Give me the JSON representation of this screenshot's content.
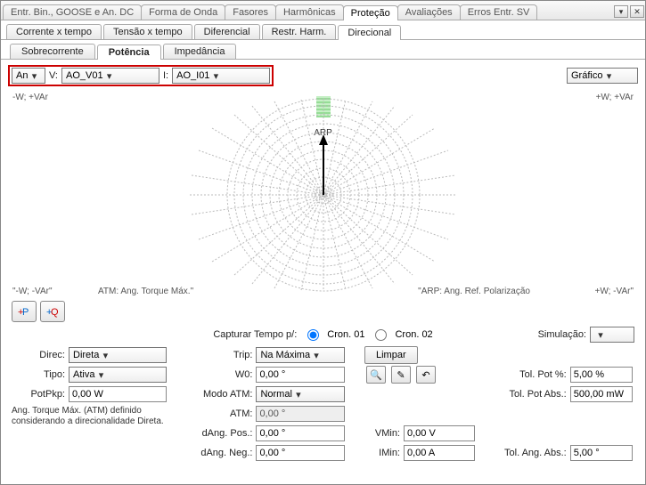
{
  "top_tabs": [
    "Entr. Bin., GOOSE e An. DC",
    "Forma de Onda",
    "Fasores",
    "Harmônicas",
    "Proteção",
    "Avaliações",
    "Erros Entr. SV"
  ],
  "top_active": 4,
  "row2_tabs": [
    "Corrente x tempo",
    "Tensão x tempo",
    "Diferencial",
    "Restr. Harm.",
    "Direcional"
  ],
  "row2_active": 4,
  "row3_tabs": [
    "Sobrecorrente",
    "Potência",
    "Impedância"
  ],
  "row3_active": 1,
  "sel": {
    "an": "An",
    "v_label": "V:",
    "v_val": "AO_V01",
    "i_label": "I:",
    "i_val": "AO_I01",
    "grafico": "Gráfico"
  },
  "chart": {
    "tl": "-W; +VAr",
    "tr": "+W; +VAr",
    "bl": "\"-W; -VAr\"",
    "br": "+W; -VAr\"",
    "arp": "ARP",
    "leg_l": "ATM: Ang. Torque Máx.\"",
    "leg_r": "\"ARP: Ang. Ref. Polarização"
  },
  "capture_label": "Capturar Tempo p/:",
  "cron1": "Cron. 01",
  "cron2": "Cron. 02",
  "sim": "Simulação:",
  "left": {
    "direc_l": "Direc:",
    "direc_v": "Direta",
    "tipo_l": "Tipo:",
    "tipo_v": "Ativa",
    "potpkp_l": "PotPkp:",
    "potpkp_v": "0,00 W",
    "note": "Ang. Torque Máx. (ATM) definido considerando a direcionalidade Direta."
  },
  "mid": {
    "trip_l": "Trip:",
    "trip_v": "Na Máxima",
    "w0_l": "W0:",
    "w0_v": "0,00 °",
    "modo_l": "Modo ATM:",
    "modo_v": "Normal",
    "atm_l": "ATM:",
    "atm_v": "0,00 °",
    "dpos_l": "dAng. Pos.:",
    "dpos_v": "0,00 °",
    "dneg_l": "dAng. Neg.:",
    "dneg_v": "0,00 °"
  },
  "btns": {
    "limpar": "Limpar"
  },
  "mins": {
    "vmin_l": "VMin:",
    "vmin_v": "0,00 V",
    "imin_l": "IMin:",
    "imin_v": "0,00 A"
  },
  "tol": {
    "pct_l": "Tol. Pot %:",
    "pct_v": "5,00 %",
    "abs_l": "Tol. Pot Abs.:",
    "abs_v": "500,00 mW",
    "ang_l": "Tol. Ang. Abs.:",
    "ang_v": "5,00 °"
  },
  "chart_data": {
    "type": "polar",
    "title": "Directional Power",
    "rings": 12,
    "spokes": 24,
    "vector": {
      "angle_deg": 90,
      "length": 1.0,
      "label": "ARP"
    },
    "atm_band": {
      "center_deg": 90,
      "width_deg": 8
    },
    "quadrants": {
      "tl": "-W;+VAr",
      "tr": "+W;+VAr",
      "bl": "-W;-VAr",
      "br": "+W;-VAr"
    }
  }
}
